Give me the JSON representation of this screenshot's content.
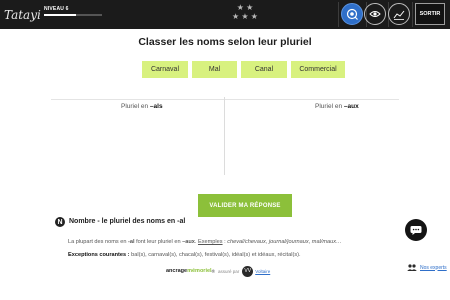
{
  "topbar": {
    "logo_text": "Tatayi",
    "level_label": "NIVEAU 6",
    "level_progress": 0.55,
    "stars": [
      "★ ★",
      "★ ★ ★"
    ],
    "sortir_label": "SORTIR",
    "icons": [
      "eye-accessibility-icon",
      "view-icon",
      "stats-chart-icon"
    ]
  },
  "exercise": {
    "title": "Classer les noms selon leur pluriel",
    "chips": [
      "Carnaval",
      "Mal",
      "Canal",
      "Commercial"
    ],
    "columns": [
      {
        "prefix": "Pluriel en ",
        "suffix": "–als"
      },
      {
        "prefix": "Pluriel en ",
        "suffix": "–aux"
      }
    ],
    "validate_label": "VALIDER MA RÉPONSE"
  },
  "rule": {
    "icon_letter": "N",
    "title": "Nombre - le pluriel des noms en -al",
    "line1_a": "La plupart des noms en ",
    "line1_b": "-al",
    "line1_c": " font leur pluriel en ",
    "line1_d": "–aux",
    "line1_e": ". ",
    "line1_ex": "Exemples",
    "line1_f": " : ",
    "line1_examples": "cheval/chevaux, journal/journaux, mal/maux…",
    "exc_label": "Exceptions courantes :",
    "exc_text": " bal(s), carnaval(s), chacal(s), festival(s), idéal(s) et idéaux, récital(s)."
  },
  "footer": {
    "brand_a": "ancrage ",
    "brand_b": "mémoriel",
    "reg": "®",
    "by": "assuré par",
    "vv": "VV",
    "partner": "Voltaire",
    "experts": "Nos experts"
  },
  "colors": {
    "topbar_bg": "#1b1b1b",
    "chip_bg": "#d8f17f",
    "validate_bg": "#8cc03a",
    "active_icon": "#2f6fc9"
  }
}
